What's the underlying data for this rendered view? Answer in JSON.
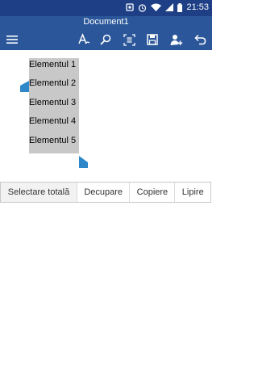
{
  "status_bar": {
    "time": "21:53",
    "icons": [
      "nfc-icon",
      "alarm-icon",
      "wifi-icon",
      "signal-icon",
      "battery-icon"
    ]
  },
  "app": {
    "title": "Document1",
    "accent": "#2b579a"
  },
  "toolbar": {
    "icons": [
      "menu-icon",
      "font-format-icon",
      "search-icon",
      "read-mode-icon",
      "save-icon",
      "share-icon",
      "undo-icon"
    ]
  },
  "document": {
    "lines": [
      "Elementul 1",
      "Elementul 2",
      "Elementul 3",
      "Elementul 4",
      "Elementul 5"
    ]
  },
  "context_menu": {
    "items": [
      "Selectare totală",
      "Decupare",
      "Copiere",
      "Lipire"
    ]
  }
}
